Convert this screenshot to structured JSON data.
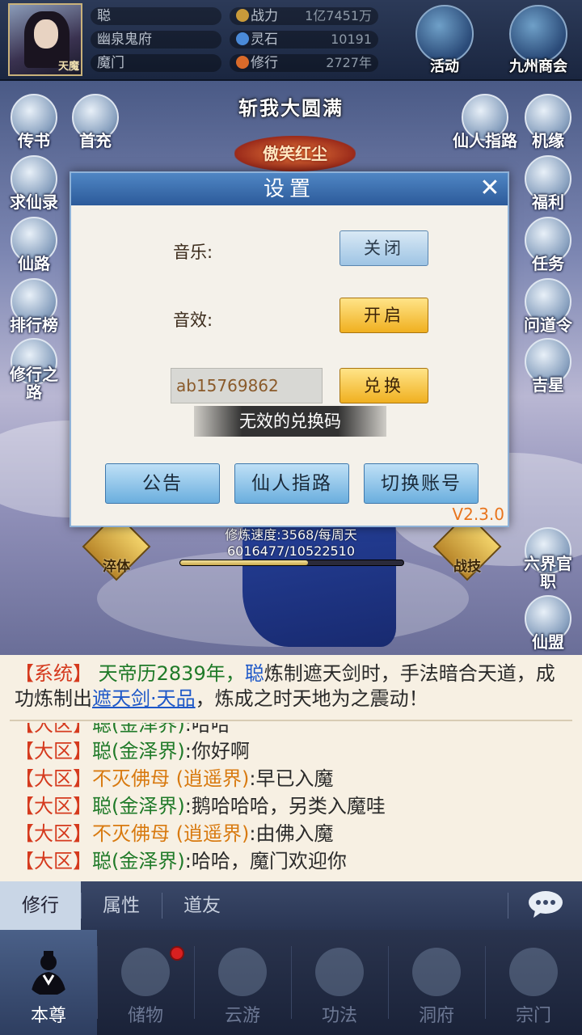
{
  "player": {
    "name": "聪",
    "avatar_tag": "天魔",
    "realm": "幽泉鬼府",
    "sect": "魔门"
  },
  "stats": [
    {
      "label": "战力",
      "value": "1亿7451万",
      "icon": "power-icon",
      "color": "#c89a3a"
    },
    {
      "label": "灵石",
      "value": "10191",
      "icon": "spirit-stone-icon",
      "color": "#4a8ad8"
    },
    {
      "label": "修行",
      "value": "2727年",
      "icon": "cultivation-icon",
      "color": "#d86a2a"
    }
  ],
  "top_buttons": [
    {
      "label": "活动",
      "icon": "activity-icon"
    },
    {
      "label": "九州商会",
      "icon": "merchant-guild-icon"
    }
  ],
  "banner": {
    "top_text": "斩我大圆满",
    "logo_text": "傲笑红尘"
  },
  "left_buttons": [
    {
      "label": "传书",
      "icon": "mail-icon"
    },
    {
      "label": "首充",
      "icon": "first-recharge-icon"
    },
    {
      "label": "求仙录",
      "icon": "scroll-icon"
    },
    {
      "label": "仙路",
      "icon": "immortal-path-icon"
    },
    {
      "label": "排行榜",
      "icon": "ranking-icon"
    },
    {
      "label": "修行之路",
      "icon": "cultivation-road-icon"
    }
  ],
  "right_buttons": [
    {
      "label": "仙人指路",
      "icon": "guide-icon"
    },
    {
      "label": "机缘",
      "icon": "fortune-icon"
    },
    {
      "label": "福利",
      "icon": "gift-icon"
    },
    {
      "label": "任务",
      "icon": "quest-icon"
    },
    {
      "label": "问道令",
      "icon": "token-icon"
    },
    {
      "label": "吉星",
      "icon": "lucky-star-icon"
    },
    {
      "label": "六界官职",
      "icon": "office-icon"
    },
    {
      "label": "仙盟",
      "icon": "alliance-icon"
    }
  ],
  "scene_buttons": {
    "left": "淬体",
    "right": "战技"
  },
  "cultivation": {
    "speed": "修炼速度:3568/每周天",
    "progress_text": "6016477/10522510",
    "progress": 0.572
  },
  "system_message": {
    "tag": "【系统】",
    "year": "天帝历2839年，",
    "name": "聪",
    "part1": "炼制遮天剑时，手法暗合天道，成功炼制出",
    "item": "遮天剑·天品",
    "part2": "，炼成之时天地为之震动！"
  },
  "chat_lines": [
    {
      "channel": "【大区】",
      "name": "聪(金泽界)",
      "name_color": "green",
      "text": ":哈哈"
    },
    {
      "channel": "【大区】",
      "name": "聪(金泽界)",
      "name_color": "green",
      "text": ":你好啊"
    },
    {
      "channel": "【大区】",
      "name": "不灭佛母 (逍遥界)",
      "name_color": "orange",
      "text": ":早已入魔"
    },
    {
      "channel": "【大区】",
      "name": "聪(金泽界)",
      "name_color": "green",
      "text": ":鹅哈哈哈，另类入魔哇"
    },
    {
      "channel": "【大区】",
      "name": "不灭佛母 (逍遥界)",
      "name_color": "orange",
      "text": ":由佛入魔"
    },
    {
      "channel": "【大区】",
      "name": "聪(金泽界)",
      "name_color": "green",
      "text": ":哈哈，魔门欢迎你"
    }
  ],
  "tabs": [
    {
      "label": "修行",
      "active": true
    },
    {
      "label": "属性",
      "active": false
    },
    {
      "label": "道友",
      "active": false
    }
  ],
  "bottom_nav": [
    {
      "label": "本尊",
      "icon": "character-icon",
      "active": true
    },
    {
      "label": "储物",
      "icon": "storage-bag-icon",
      "active": false
    },
    {
      "label": "云游",
      "icon": "travel-mountain-icon",
      "active": false
    },
    {
      "label": "功法",
      "icon": "technique-icon",
      "active": false
    },
    {
      "label": "洞府",
      "icon": "cave-icon",
      "active": false
    },
    {
      "label": "宗门",
      "icon": "sect-gate-icon",
      "active": false
    }
  ],
  "dialog": {
    "title": "设置",
    "music_label": "音乐:",
    "music_state": "关闭",
    "sfx_label": "音效:",
    "sfx_state": "开启",
    "code_value": "ab15769862",
    "redeem_label": "兑换",
    "error_text": "无效的兑换码",
    "buttons": [
      "公告",
      "仙人指路",
      "切换账号"
    ],
    "version": "V2.3.0"
  }
}
